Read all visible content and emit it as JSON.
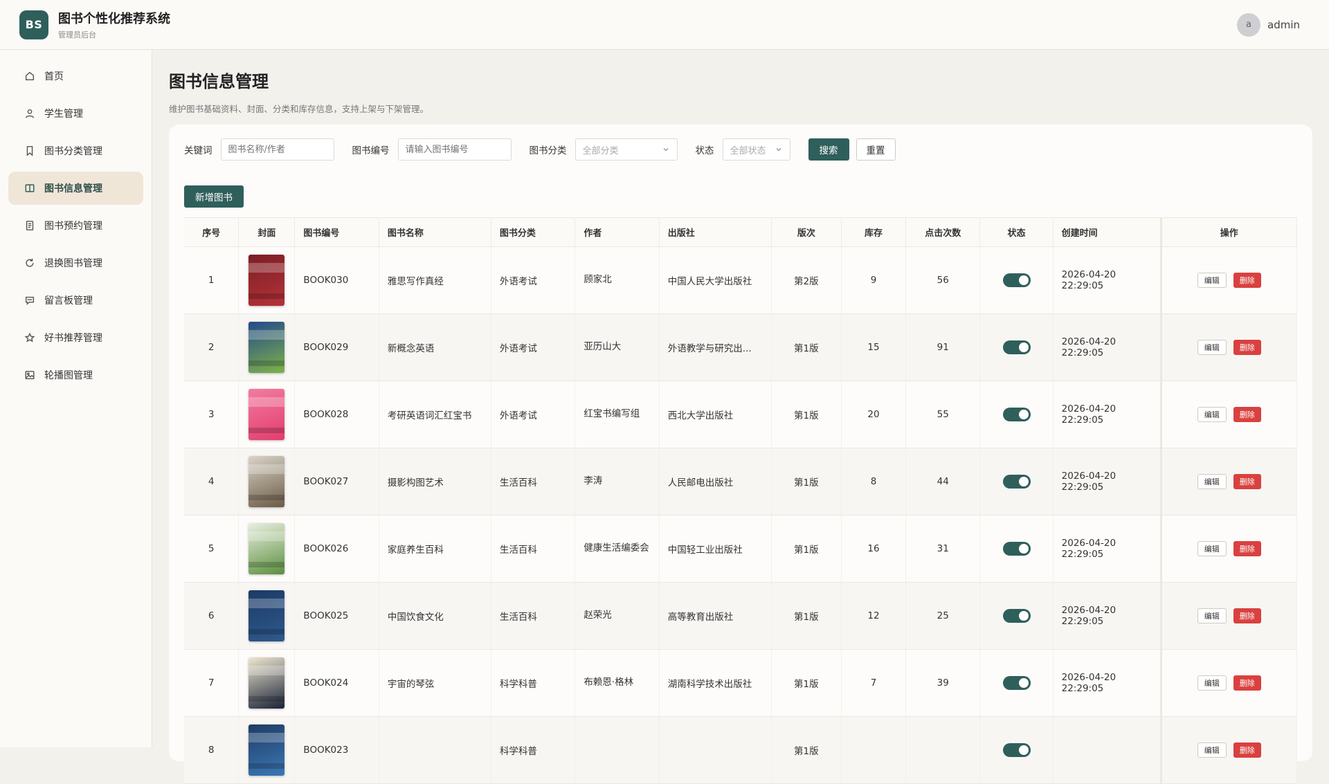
{
  "header": {
    "logo_text": "BS",
    "title": "图书个性化推荐系统",
    "subtitle": "管理员后台",
    "avatar_letter": "a",
    "username": "admin"
  },
  "sidebar": {
    "items": [
      {
        "label": "首页",
        "icon": "home-icon",
        "active": false
      },
      {
        "label": "学生管理",
        "icon": "user-icon",
        "active": false
      },
      {
        "label": "图书分类管理",
        "icon": "bookmark-icon",
        "active": false
      },
      {
        "label": "图书信息管理",
        "icon": "book-open-icon",
        "active": true
      },
      {
        "label": "图书预约管理",
        "icon": "document-icon",
        "active": false
      },
      {
        "label": "退换图书管理",
        "icon": "refresh-icon",
        "active": false
      },
      {
        "label": "留言板管理",
        "icon": "message-icon",
        "active": false
      },
      {
        "label": "好书推荐管理",
        "icon": "star-icon",
        "active": false
      },
      {
        "label": "轮播图管理",
        "icon": "image-icon",
        "active": false
      }
    ]
  },
  "page": {
    "title": "图书信息管理",
    "description": "维护图书基础资料、封面、分类和库存信息，支持上架与下架管理。"
  },
  "filters": {
    "keyword_label": "关键词",
    "keyword_placeholder": "图书名称/作者",
    "code_label": "图书编号",
    "code_placeholder": "请输入图书编号",
    "category_label": "图书分类",
    "category_value": "全部分类",
    "status_label": "状态",
    "status_value": "全部状态",
    "search_label": "搜索",
    "reset_label": "重置"
  },
  "add_button_label": "新增图书",
  "table": {
    "columns": [
      "序号",
      "封面",
      "图书编号",
      "图书名称",
      "图书分类",
      "作者",
      "出版社",
      "版次",
      "库存",
      "点击次数",
      "状态",
      "创建时间",
      "操作"
    ],
    "edit_label": "编辑",
    "delete_label": "删除",
    "rows": [
      {
        "index": "1",
        "code": "BOOK030",
        "name": "雅思写作真经",
        "category": "外语考试",
        "author": "顾家北",
        "publisher": "中国人民大学出版社",
        "edition": "第2版",
        "stock": "9",
        "clicks": "56",
        "enabled": true,
        "created": "2026-04-20 22:29:05",
        "cover_colors": [
          "#7a1f24",
          "#b5323a"
        ]
      },
      {
        "index": "2",
        "code": "BOOK029",
        "name": "新概念英语",
        "category": "外语考试",
        "author": "亚历山大",
        "publisher": "外语教学与研究出...",
        "edition": "第1版",
        "stock": "15",
        "clicks": "91",
        "enabled": true,
        "created": "2026-04-20 22:29:05",
        "cover_colors": [
          "#234a8a",
          "#7fb24a"
        ]
      },
      {
        "index": "3",
        "code": "BOOK028",
        "name": "考研英语词汇红宝书",
        "category": "外语考试",
        "author": "红宝书编写组",
        "publisher": "西北大学出版社",
        "edition": "第1版",
        "stock": "20",
        "clicks": "55",
        "enabled": true,
        "created": "2026-04-20 22:29:05",
        "cover_colors": [
          "#f17ca0",
          "#e23d6e"
        ]
      },
      {
        "index": "4",
        "code": "BOOK027",
        "name": "摄影构图艺术",
        "category": "生活百科",
        "author": "李涛",
        "publisher": "人民邮电出版社",
        "edition": "第1版",
        "stock": "8",
        "clicks": "44",
        "enabled": true,
        "created": "2026-04-20 22:29:05",
        "cover_colors": [
          "#d9d4c8",
          "#6b5a45"
        ]
      },
      {
        "index": "5",
        "code": "BOOK026",
        "name": "家庭养生百科",
        "category": "生活百科",
        "author": "健康生活编委会",
        "publisher": "中国轻工业出版社",
        "edition": "第1版",
        "stock": "16",
        "clicks": "31",
        "enabled": true,
        "created": "2026-04-20 22:29:05",
        "cover_colors": [
          "#e9efe0",
          "#5b8f3e"
        ]
      },
      {
        "index": "6",
        "code": "BOOK025",
        "name": "中国饮食文化",
        "category": "生活百科",
        "author": "赵荣光",
        "publisher": "高等教育出版社",
        "edition": "第1版",
        "stock": "12",
        "clicks": "25",
        "enabled": true,
        "created": "2026-04-20 22:29:05",
        "cover_colors": [
          "#1d3a66",
          "#2e5a8c"
        ]
      },
      {
        "index": "7",
        "code": "BOOK024",
        "name": "宇宙的琴弦",
        "category": "科学科普",
        "author": "布赖恩·格林",
        "publisher": "湖南科学技术出版社",
        "edition": "第1版",
        "stock": "7",
        "clicks": "39",
        "enabled": true,
        "created": "2026-04-20 22:29:05",
        "cover_colors": [
          "#efe8d0",
          "#1a2238"
        ]
      },
      {
        "index": "8",
        "code": "BOOK023",
        "name": "",
        "category": "科学科普",
        "author": "",
        "publisher": "",
        "edition": "第1版",
        "stock": "",
        "clicks": "",
        "enabled": true,
        "created": "",
        "cover_colors": [
          "#1f3b63",
          "#3b78b5"
        ]
      }
    ]
  },
  "colors": {
    "primary": "#2f5f5b",
    "danger": "#d9413f",
    "active_nav_bg": "#efe6d8"
  }
}
